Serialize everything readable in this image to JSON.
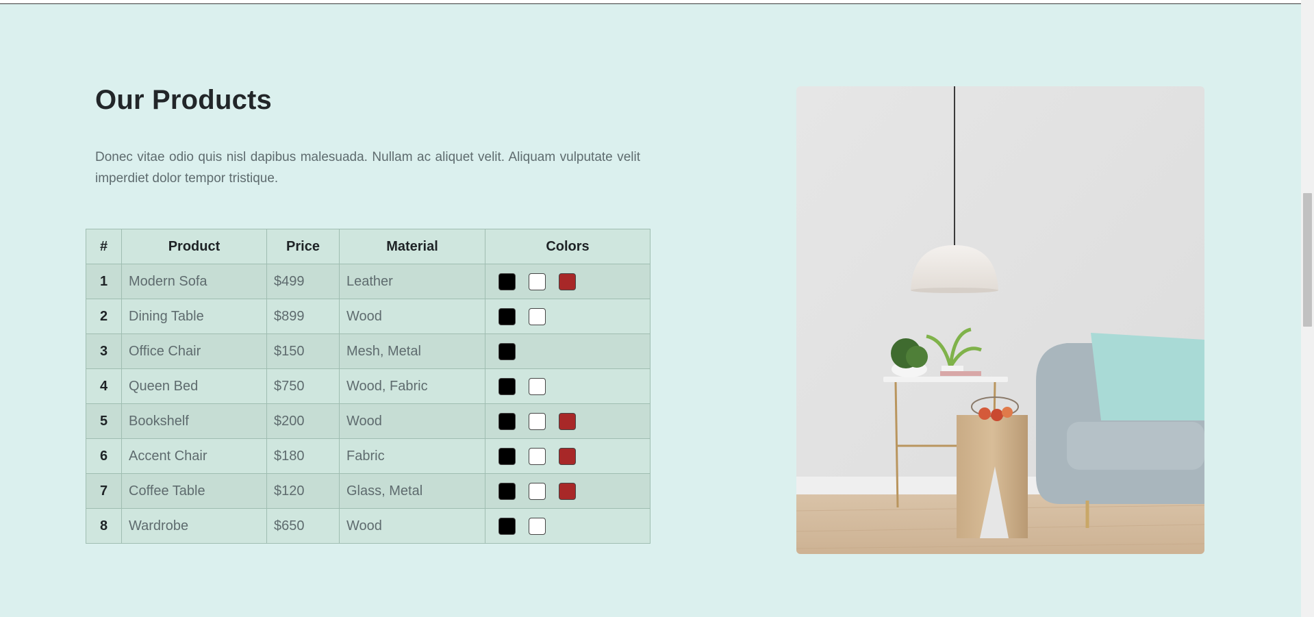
{
  "section": {
    "title": "Our Products",
    "description": "Donec vitae odio quis nisl dapibus malesuada. Nullam ac aliquet velit. Aliquam vulputate velit imperdiet dolor tempor tristique."
  },
  "table": {
    "headers": {
      "num": "#",
      "product": "Product",
      "price": "Price",
      "material": "Material",
      "colors": "Colors"
    },
    "rows": [
      {
        "num": "1",
        "product": "Modern Sofa",
        "price": "$499",
        "material": "Leather",
        "colors": [
          "#000000",
          "#ffffff",
          "#a82828"
        ]
      },
      {
        "num": "2",
        "product": "Dining Table",
        "price": "$899",
        "material": "Wood",
        "colors": [
          "#000000",
          "#ffffff"
        ]
      },
      {
        "num": "3",
        "product": "Office Chair",
        "price": "$150",
        "material": "Mesh, Metal",
        "colors": [
          "#000000"
        ]
      },
      {
        "num": "4",
        "product": "Queen Bed",
        "price": "$750",
        "material": "Wood, Fabric",
        "colors": [
          "#000000",
          "#ffffff"
        ]
      },
      {
        "num": "5",
        "product": "Bookshelf",
        "price": "$200",
        "material": "Wood",
        "colors": [
          "#000000",
          "#ffffff",
          "#a82828"
        ]
      },
      {
        "num": "6",
        "product": "Accent Chair",
        "price": "$180",
        "material": "Fabric",
        "colors": [
          "#000000",
          "#ffffff",
          "#a82828"
        ]
      },
      {
        "num": "7",
        "product": "Coffee Table",
        "price": "$120",
        "material": "Glass, Metal",
        "colors": [
          "#000000",
          "#ffffff",
          "#a82828"
        ]
      },
      {
        "num": "8",
        "product": "Wardrobe",
        "price": "$650",
        "material": "Wood",
        "colors": [
          "#000000",
          "#ffffff"
        ]
      }
    ]
  },
  "image": {
    "subject": "living room with pendant lamp, side table with plants, wooden stool and grey sofa"
  },
  "theme": {
    "background": "#dbf0ee",
    "table_header": "#cfe6de",
    "table_row_alt": "#c6ddd4"
  }
}
